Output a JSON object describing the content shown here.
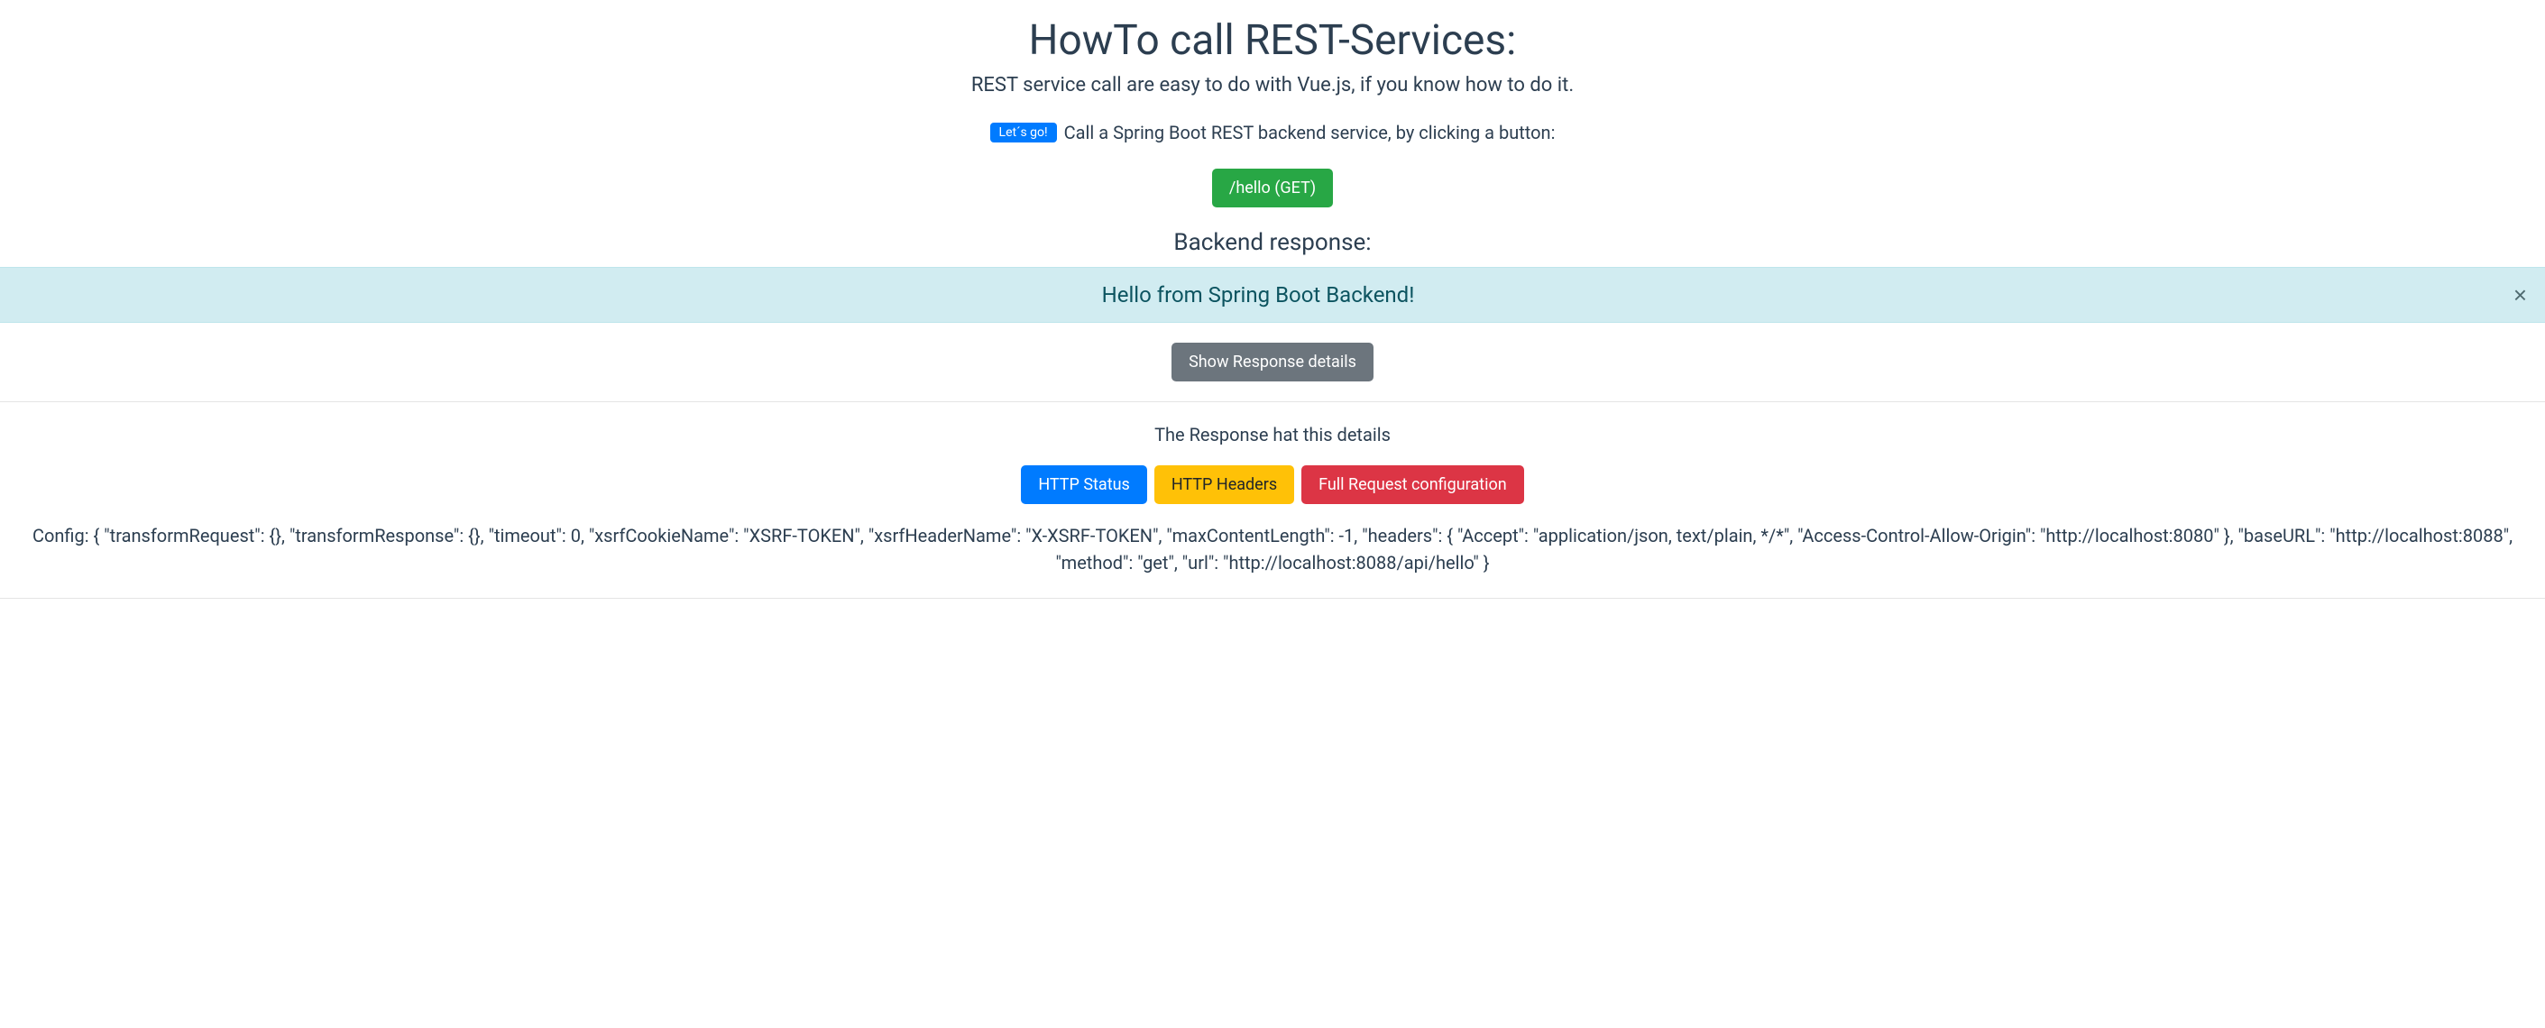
{
  "header": {
    "title": "HowTo call REST-Services:",
    "subtitle": "REST service call are easy to do with Vue.js, if you know how to do it."
  },
  "cta": {
    "badge": "Let´s go!",
    "text": "Call a Spring Boot REST backend service, by clicking a button:"
  },
  "actions": {
    "hello_get": "/hello (GET)"
  },
  "response": {
    "heading": "Backend response:",
    "message": "Hello from Spring Boot Backend!",
    "close_label": "×"
  },
  "details": {
    "toggle_label": "Show Response details",
    "caption": "The Response hat this details",
    "tabs": {
      "status": "HTTP Status",
      "headers": "HTTP Headers",
      "config": "Full Request configuration"
    },
    "config_text": "Config: { \"transformRequest\": {}, \"transformResponse\": {}, \"timeout\": 0, \"xsrfCookieName\": \"XSRF-TOKEN\", \"xsrfHeaderName\": \"X-XSRF-TOKEN\", \"maxContentLength\": -1, \"headers\": { \"Accept\": \"application/json, text/plain, */*\", \"Access-Control-Allow-Origin\": \"http://localhost:8080\" }, \"baseURL\": \"http://localhost:8088\", \"method\": \"get\", \"url\": \"http://localhost:8088/api/hello\" }"
  }
}
